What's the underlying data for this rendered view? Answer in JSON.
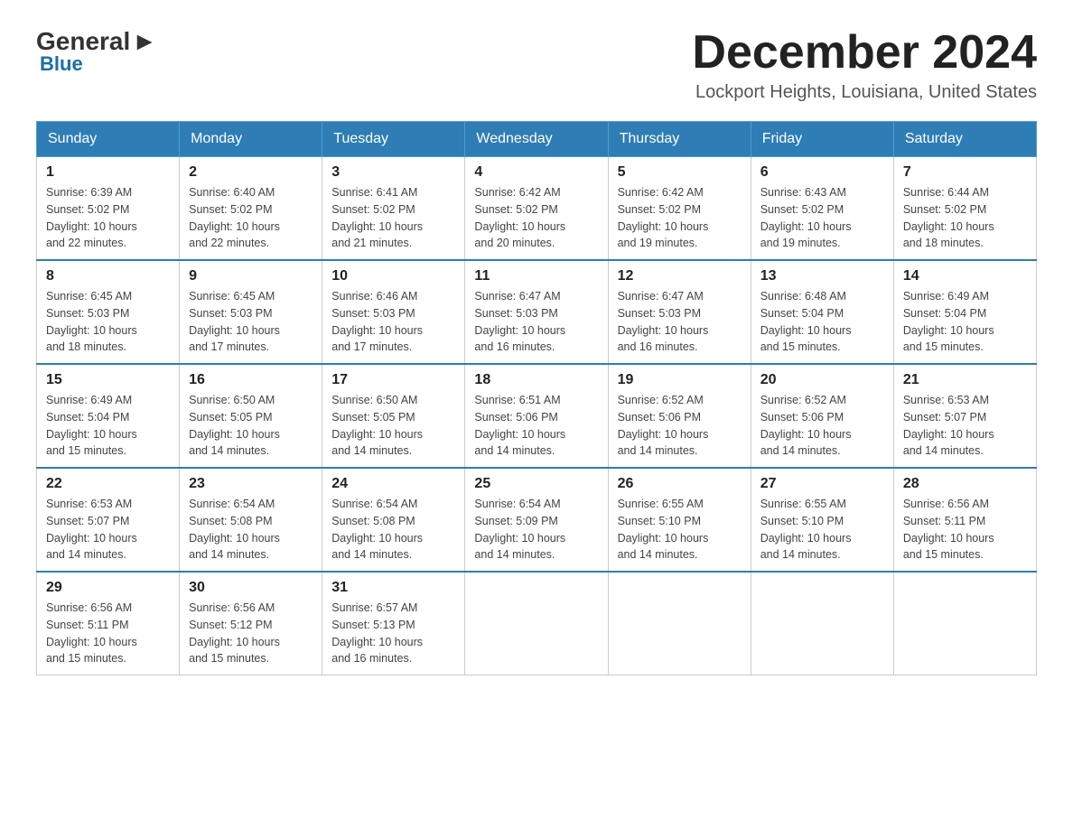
{
  "logo": {
    "general": "General",
    "blue": "Blue"
  },
  "header": {
    "month": "December 2024",
    "location": "Lockport Heights, Louisiana, United States"
  },
  "days_of_week": [
    "Sunday",
    "Monday",
    "Tuesday",
    "Wednesday",
    "Thursday",
    "Friday",
    "Saturday"
  ],
  "weeks": [
    [
      {
        "day": "1",
        "sunrise": "6:39 AM",
        "sunset": "5:02 PM",
        "daylight": "10 hours and 22 minutes."
      },
      {
        "day": "2",
        "sunrise": "6:40 AM",
        "sunset": "5:02 PM",
        "daylight": "10 hours and 22 minutes."
      },
      {
        "day": "3",
        "sunrise": "6:41 AM",
        "sunset": "5:02 PM",
        "daylight": "10 hours and 21 minutes."
      },
      {
        "day": "4",
        "sunrise": "6:42 AM",
        "sunset": "5:02 PM",
        "daylight": "10 hours and 20 minutes."
      },
      {
        "day": "5",
        "sunrise": "6:42 AM",
        "sunset": "5:02 PM",
        "daylight": "10 hours and 19 minutes."
      },
      {
        "day": "6",
        "sunrise": "6:43 AM",
        "sunset": "5:02 PM",
        "daylight": "10 hours and 19 minutes."
      },
      {
        "day": "7",
        "sunrise": "6:44 AM",
        "sunset": "5:02 PM",
        "daylight": "10 hours and 18 minutes."
      }
    ],
    [
      {
        "day": "8",
        "sunrise": "6:45 AM",
        "sunset": "5:03 PM",
        "daylight": "10 hours and 18 minutes."
      },
      {
        "day": "9",
        "sunrise": "6:45 AM",
        "sunset": "5:03 PM",
        "daylight": "10 hours and 17 minutes."
      },
      {
        "day": "10",
        "sunrise": "6:46 AM",
        "sunset": "5:03 PM",
        "daylight": "10 hours and 17 minutes."
      },
      {
        "day": "11",
        "sunrise": "6:47 AM",
        "sunset": "5:03 PM",
        "daylight": "10 hours and 16 minutes."
      },
      {
        "day": "12",
        "sunrise": "6:47 AM",
        "sunset": "5:03 PM",
        "daylight": "10 hours and 16 minutes."
      },
      {
        "day": "13",
        "sunrise": "6:48 AM",
        "sunset": "5:04 PM",
        "daylight": "10 hours and 15 minutes."
      },
      {
        "day": "14",
        "sunrise": "6:49 AM",
        "sunset": "5:04 PM",
        "daylight": "10 hours and 15 minutes."
      }
    ],
    [
      {
        "day": "15",
        "sunrise": "6:49 AM",
        "sunset": "5:04 PM",
        "daylight": "10 hours and 15 minutes."
      },
      {
        "day": "16",
        "sunrise": "6:50 AM",
        "sunset": "5:05 PM",
        "daylight": "10 hours and 14 minutes."
      },
      {
        "day": "17",
        "sunrise": "6:50 AM",
        "sunset": "5:05 PM",
        "daylight": "10 hours and 14 minutes."
      },
      {
        "day": "18",
        "sunrise": "6:51 AM",
        "sunset": "5:06 PM",
        "daylight": "10 hours and 14 minutes."
      },
      {
        "day": "19",
        "sunrise": "6:52 AM",
        "sunset": "5:06 PM",
        "daylight": "10 hours and 14 minutes."
      },
      {
        "day": "20",
        "sunrise": "6:52 AM",
        "sunset": "5:06 PM",
        "daylight": "10 hours and 14 minutes."
      },
      {
        "day": "21",
        "sunrise": "6:53 AM",
        "sunset": "5:07 PM",
        "daylight": "10 hours and 14 minutes."
      }
    ],
    [
      {
        "day": "22",
        "sunrise": "6:53 AM",
        "sunset": "5:07 PM",
        "daylight": "10 hours and 14 minutes."
      },
      {
        "day": "23",
        "sunrise": "6:54 AM",
        "sunset": "5:08 PM",
        "daylight": "10 hours and 14 minutes."
      },
      {
        "day": "24",
        "sunrise": "6:54 AM",
        "sunset": "5:08 PM",
        "daylight": "10 hours and 14 minutes."
      },
      {
        "day": "25",
        "sunrise": "6:54 AM",
        "sunset": "5:09 PM",
        "daylight": "10 hours and 14 minutes."
      },
      {
        "day": "26",
        "sunrise": "6:55 AM",
        "sunset": "5:10 PM",
        "daylight": "10 hours and 14 minutes."
      },
      {
        "day": "27",
        "sunrise": "6:55 AM",
        "sunset": "5:10 PM",
        "daylight": "10 hours and 14 minutes."
      },
      {
        "day": "28",
        "sunrise": "6:56 AM",
        "sunset": "5:11 PM",
        "daylight": "10 hours and 15 minutes."
      }
    ],
    [
      {
        "day": "29",
        "sunrise": "6:56 AM",
        "sunset": "5:11 PM",
        "daylight": "10 hours and 15 minutes."
      },
      {
        "day": "30",
        "sunrise": "6:56 AM",
        "sunset": "5:12 PM",
        "daylight": "10 hours and 15 minutes."
      },
      {
        "day": "31",
        "sunrise": "6:57 AM",
        "sunset": "5:13 PM",
        "daylight": "10 hours and 16 minutes."
      },
      null,
      null,
      null,
      null
    ]
  ],
  "labels": {
    "sunrise": "Sunrise:",
    "sunset": "Sunset:",
    "daylight": "Daylight:"
  }
}
